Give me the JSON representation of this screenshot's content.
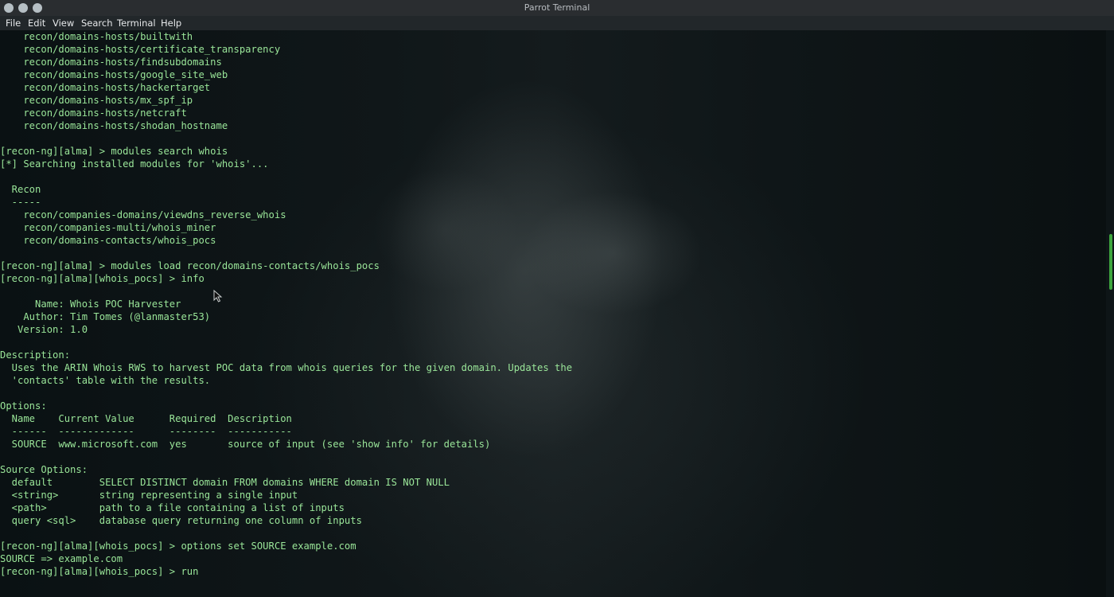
{
  "window": {
    "title": "Parrot Terminal"
  },
  "menu": [
    "File",
    "Edit",
    "View",
    "Search",
    "Terminal",
    "Help"
  ],
  "terminal": {
    "lines": [
      "    recon/domains-hosts/builtwith",
      "    recon/domains-hosts/certificate_transparency",
      "    recon/domains-hosts/findsubdomains",
      "    recon/domains-hosts/google_site_web",
      "    recon/domains-hosts/hackertarget",
      "    recon/domains-hosts/mx_spf_ip",
      "    recon/domains-hosts/netcraft",
      "    recon/domains-hosts/shodan_hostname",
      "",
      "[recon-ng][alma] > modules search whois",
      "[*] Searching installed modules for 'whois'...",
      "",
      "  Recon",
      "  -----",
      "    recon/companies-domains/viewdns_reverse_whois",
      "    recon/companies-multi/whois_miner",
      "    recon/domains-contacts/whois_pocs",
      "",
      "[recon-ng][alma] > modules load recon/domains-contacts/whois_pocs",
      "[recon-ng][alma][whois_pocs] > info",
      "",
      "      Name: Whois POC Harvester",
      "    Author: Tim Tomes (@lanmaster53)",
      "   Version: 1.0",
      "",
      "Description:",
      "  Uses the ARIN Whois RWS to harvest POC data from whois queries for the given domain. Updates the",
      "  'contacts' table with the results.",
      "",
      "Options:",
      "  Name    Current Value      Required  Description",
      "  ------  -------------      --------  -----------",
      "  SOURCE  www.microsoft.com  yes       source of input (see 'show info' for details)",
      "",
      "Source Options:",
      "  default        SELECT DISTINCT domain FROM domains WHERE domain IS NOT NULL",
      "  <string>       string representing a single input",
      "  <path>         path to a file containing a list of inputs",
      "  query <sql>    database query returning one column of inputs",
      "",
      "[recon-ng][alma][whois_pocs] > options set SOURCE example.com",
      "SOURCE => example.com",
      "[recon-ng][alma][whois_pocs] > run"
    ]
  }
}
